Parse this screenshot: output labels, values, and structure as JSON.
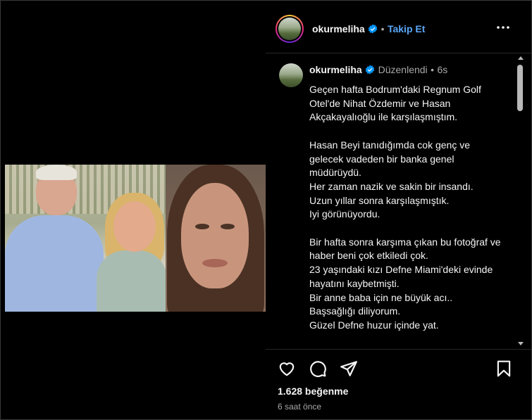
{
  "post": {
    "username": "okurmeliha",
    "follow_label": "Takip Et",
    "separator": "•",
    "edited_label": "Düzenlendi",
    "comment_age": "6s",
    "caption": "Geçen hafta Bodrum'daki Regnum Golf Otel'de Nihat Özdemir ve Hasan Akçakayalıoğlu ile karşılaşmıştım.\n\nHasan Beyi tanıdığımda cok genç ve gelecek vadeden bir banka genel müdürüydü.\nHer zaman nazik ve sakin bir insandı.\nUzun yıllar sonra karşılaşmıştık.\nIyi görünüyordu.\n\nBir hafta sonra karşıma çıkan bu fotoğraf ve haber beni çok etkiledi çok.\n23 yaşındaki kızı Defne Miami'deki evinde hayatını kaybetmişti.\nBir anne baba için ne büyük acı..\nBaşsağlığı diliyorum.\nGüzel Defne huzur içinde yat.\n\nSevgiyle",
    "likes": "1.628 beğenme",
    "timestamp": "6 saat önce"
  },
  "icons": {
    "more": "more-horizontal-icon",
    "like": "heart-icon",
    "comment": "comment-icon",
    "share": "send-icon",
    "save": "bookmark-icon",
    "verified": "verified-badge-icon"
  },
  "colors": {
    "background": "#000000",
    "text": "#f5f5f5",
    "muted": "#a8a8a8",
    "link": "#5aa7f7",
    "verified": "#0095f6"
  }
}
